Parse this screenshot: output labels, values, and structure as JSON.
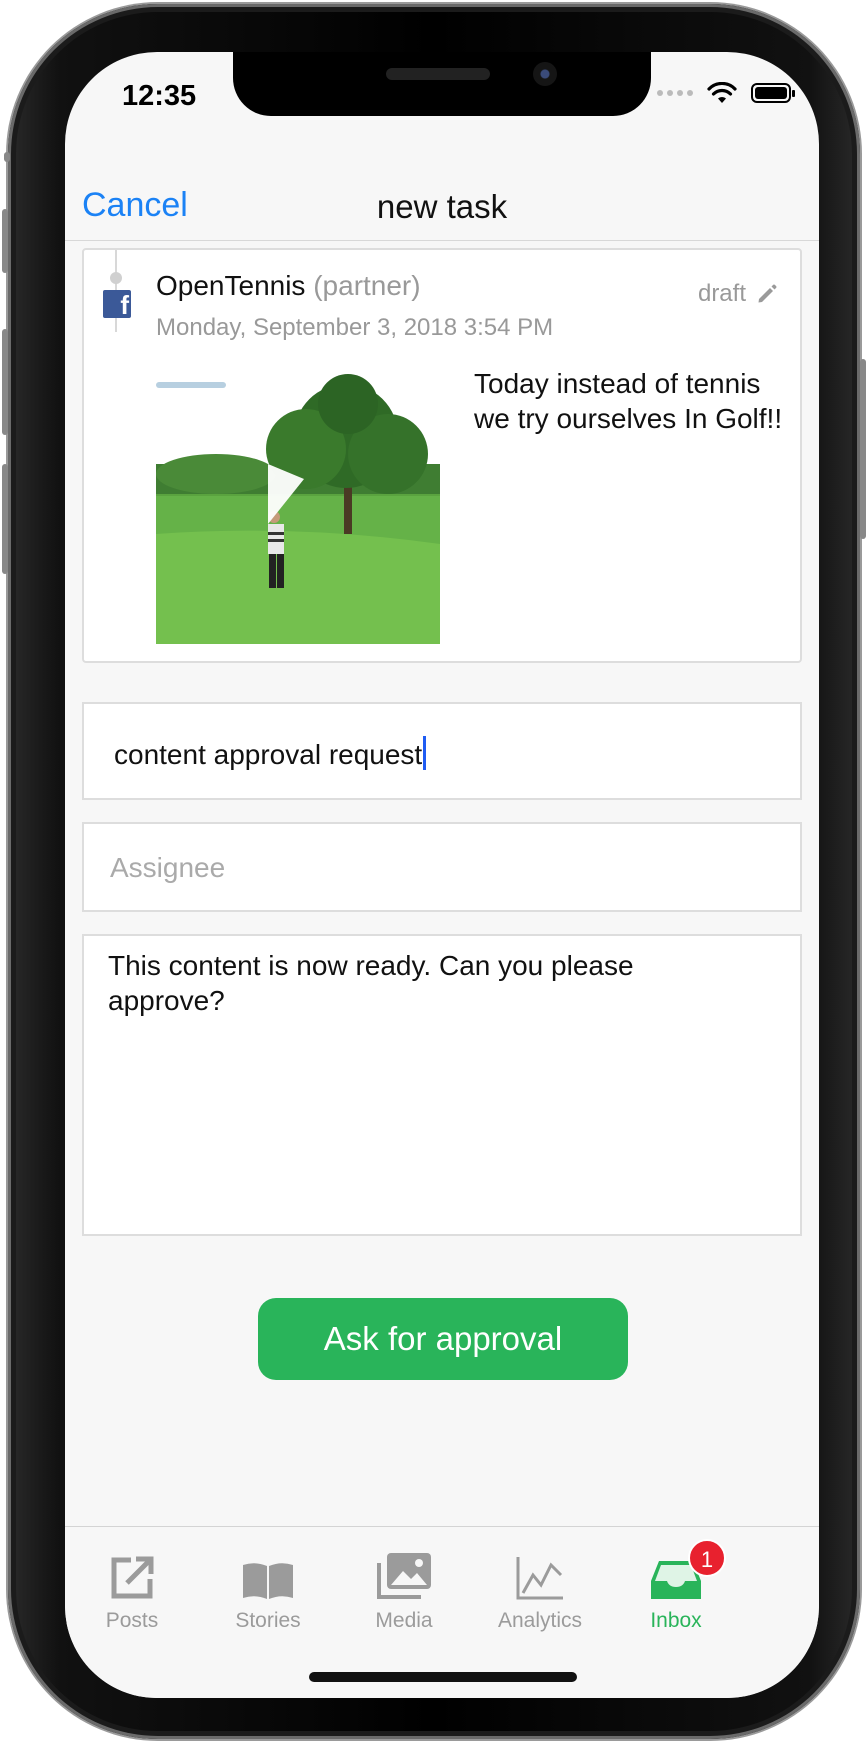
{
  "status_bar": {
    "time": "12:35"
  },
  "nav": {
    "cancel_label": "Cancel",
    "title": "new task"
  },
  "post": {
    "account_name": "OpenTennis",
    "account_role": "(partner)",
    "date": "Monday, September 3, 2018 3:54 PM",
    "status": "draft",
    "text": "Today instead of tennis we try ourselves In Golf!!"
  },
  "form": {
    "subject_value": "content approval request",
    "assignee_placeholder": "Assignee",
    "message_value": "This content is now ready. Can you please approve?"
  },
  "actions": {
    "approve_label": "Ask for approval"
  },
  "tabbar": {
    "items": [
      {
        "label": "Posts",
        "icon": "external-link-icon"
      },
      {
        "label": "Stories",
        "icon": "book-icon"
      },
      {
        "label": "Media",
        "icon": "photos-icon"
      },
      {
        "label": "Analytics",
        "icon": "chart-icon"
      },
      {
        "label": "Inbox",
        "icon": "inbox-icon",
        "badge": "1",
        "active": true
      }
    ]
  },
  "colors": {
    "accent_blue": "#1b82f5",
    "approve_green": "#29b45a",
    "badge_red": "#e8212e",
    "facebook_blue": "#3b5998"
  }
}
